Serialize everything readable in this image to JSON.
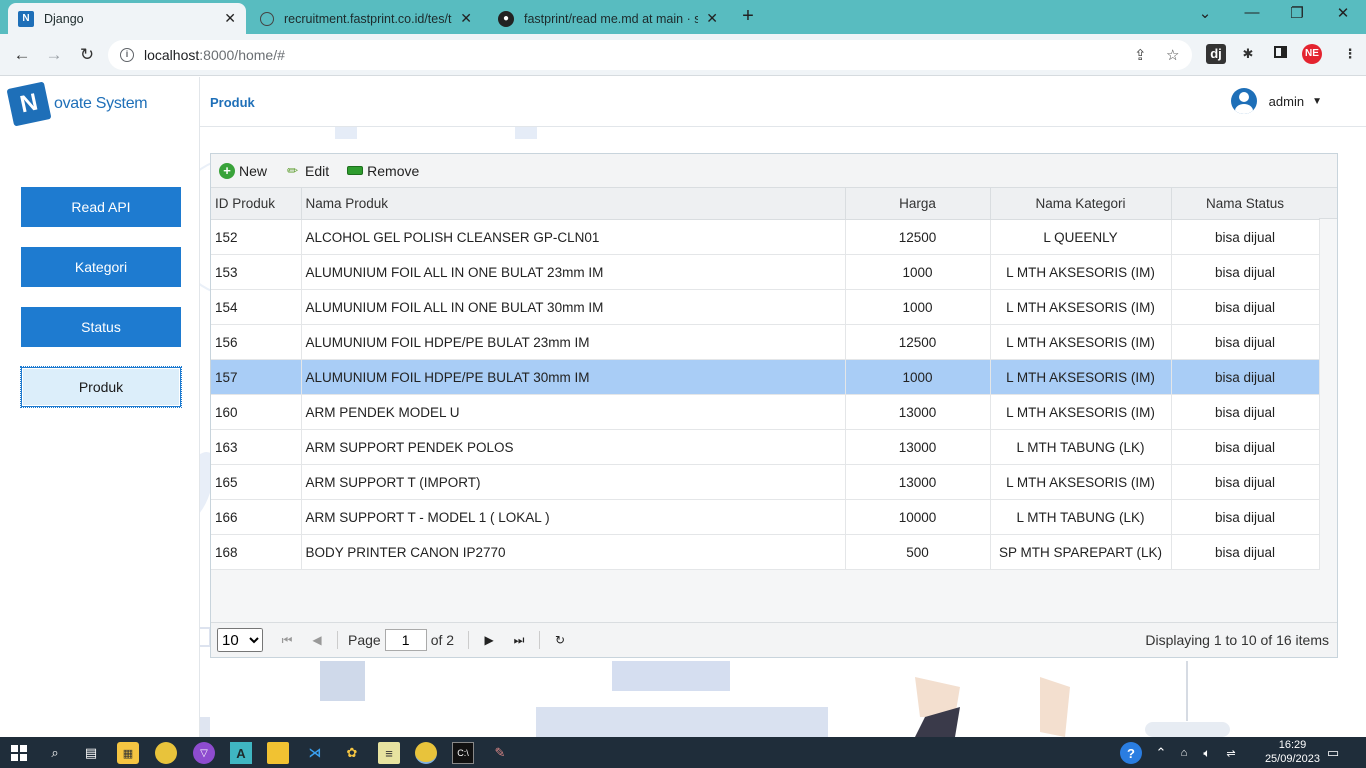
{
  "browser": {
    "tabs": [
      {
        "label": "Django",
        "favicon": "N"
      },
      {
        "label": "recruitment.fastprint.co.id/tes/te",
        "favicon": "globe"
      },
      {
        "label": "fastprint/read me.md at main · s",
        "favicon": "github"
      }
    ],
    "url_host": "localhost",
    "url_rest": ":8000/home/#"
  },
  "app": {
    "logo_letter": "N",
    "logo_text": "ovate System",
    "page_title": "Produk",
    "user_name": "admin"
  },
  "sidebar": {
    "items": [
      {
        "label": "Read API"
      },
      {
        "label": "Kategori"
      },
      {
        "label": "Status"
      },
      {
        "label": "Produk"
      }
    ]
  },
  "grid": {
    "toolbar": {
      "new": "New",
      "edit": "Edit",
      "remove": "Remove"
    },
    "columns": [
      "ID Produk",
      "Nama Produk",
      "Harga",
      "Nama Kategori",
      "Nama Status"
    ],
    "rows": [
      {
        "id": "152",
        "nama": "ALCOHOL GEL POLISH CLEANSER GP-CLN01",
        "harga": "12500",
        "kategori": "L QUEENLY",
        "status": "bisa dijual"
      },
      {
        "id": "153",
        "nama": "ALUMUNIUM FOIL ALL IN ONE BULAT 23mm IM",
        "harga": "1000",
        "kategori": "L MTH AKSESORIS (IM)",
        "status": "bisa dijual"
      },
      {
        "id": "154",
        "nama": "ALUMUNIUM FOIL ALL IN ONE BULAT 30mm IM",
        "harga": "1000",
        "kategori": "L MTH AKSESORIS (IM)",
        "status": "bisa dijual"
      },
      {
        "id": "156",
        "nama": "ALUMUNIUM FOIL HDPE/PE BULAT 23mm IM",
        "harga": "12500",
        "kategori": "L MTH AKSESORIS (IM)",
        "status": "bisa dijual"
      },
      {
        "id": "157",
        "nama": "ALUMUNIUM FOIL HDPE/PE BULAT 30mm IM",
        "harga": "1000",
        "kategori": "L MTH AKSESORIS (IM)",
        "status": "bisa dijual"
      },
      {
        "id": "160",
        "nama": "ARM PENDEK MODEL U",
        "harga": "13000",
        "kategori": "L MTH AKSESORIS (IM)",
        "status": "bisa dijual"
      },
      {
        "id": "163",
        "nama": "ARM SUPPORT PENDEK POLOS",
        "harga": "13000",
        "kategori": "L MTH TABUNG (LK)",
        "status": "bisa dijual"
      },
      {
        "id": "165",
        "nama": "ARM SUPPORT T (IMPORT)",
        "harga": "13000",
        "kategori": "L MTH AKSESORIS (IM)",
        "status": "bisa dijual"
      },
      {
        "id": "166",
        "nama": "ARM SUPPORT T - MODEL 1 ( LOKAL )",
        "harga": "10000",
        "kategori": "L MTH TABUNG (LK)",
        "status": "bisa dijual"
      },
      {
        "id": "168",
        "nama": "BODY PRINTER CANON IP2770",
        "harga": "500",
        "kategori": "SP MTH SPAREPART (LK)",
        "status": "bisa dijual"
      }
    ],
    "selected_row": 4,
    "pager": {
      "page_size": "10",
      "page_label": "Page",
      "current_page": "1",
      "of_label": "of 2",
      "info": "Displaying 1 to 10 of 16 items"
    }
  },
  "taskbar": {
    "time": "16:29",
    "date": "25/09/2023"
  },
  "colors": {
    "tabbar": "#58bcc0",
    "accent": "#1e7bd0",
    "selected_row": "#a9cdf6"
  }
}
